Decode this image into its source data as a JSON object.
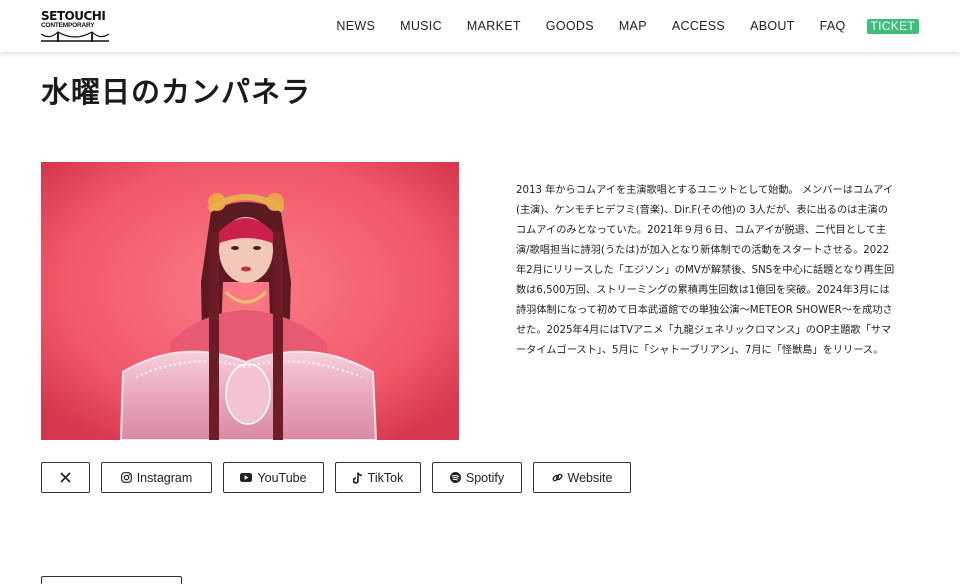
{
  "header": {
    "logo": {
      "line1": "SETOUCHI",
      "line2": "CONTEMPORARY"
    },
    "nav": [
      {
        "label": "NEWS"
      },
      {
        "label": "MUSIC"
      },
      {
        "label": "MARKET"
      },
      {
        "label": "GOODS"
      },
      {
        "label": "MAP"
      },
      {
        "label": "ACCESS"
      },
      {
        "label": "ABOUT"
      },
      {
        "label": "FAQ"
      }
    ],
    "ticket_label": "TICKET"
  },
  "artist": {
    "name": "水曜日のカンパネラ",
    "description_lines": [
      "2013 年からコムアイを主演歌唱とするユニットとして始動。 メンバーはコムアイ",
      "(主演)、ケンモチヒデフミ(音楽)、Dir.F(その他)の 3人だが、表に出るのは主演の",
      "コムアイのみとなっていた。2021年９月６日、コムアイが脱退、二代目として主",
      "演/歌唱担当に詩羽(うたは)が加入となり新体制での活動をスタートさせる。2022",
      "年2月にリリースした「エジソン」のMVが解禁後、SNSを中心に話題となり再生回",
      "数は6,500万回、ストリーミングの累積再生回数は1億回を突破。2024年3月には",
      "詩羽体制になって初めて日本武道館での単独公演〜METEOR SHOWER〜を成功さ",
      "せた。2025年4月にはTVアニメ「九龍ジェネリックロマンス」のOP主題歌「サマ",
      "ータイムゴースト」、5月に「シャトーブリアン」、7月に「怪獣島」をリリース。"
    ]
  },
  "socials": [
    {
      "label": "",
      "icon": "x-icon"
    },
    {
      "label": "Instagram",
      "icon": "instagram-icon"
    },
    {
      "label": "YouTube",
      "icon": "youtube-icon"
    },
    {
      "label": "TikTok",
      "icon": "tiktok-icon"
    },
    {
      "label": "Spotify",
      "icon": "spotify-icon"
    },
    {
      "label": "Website",
      "icon": "link-icon"
    }
  ],
  "colors": {
    "ticket_bg": "#3dbf7b",
    "photo_bg": "#f0576a",
    "text": "#222222"
  }
}
